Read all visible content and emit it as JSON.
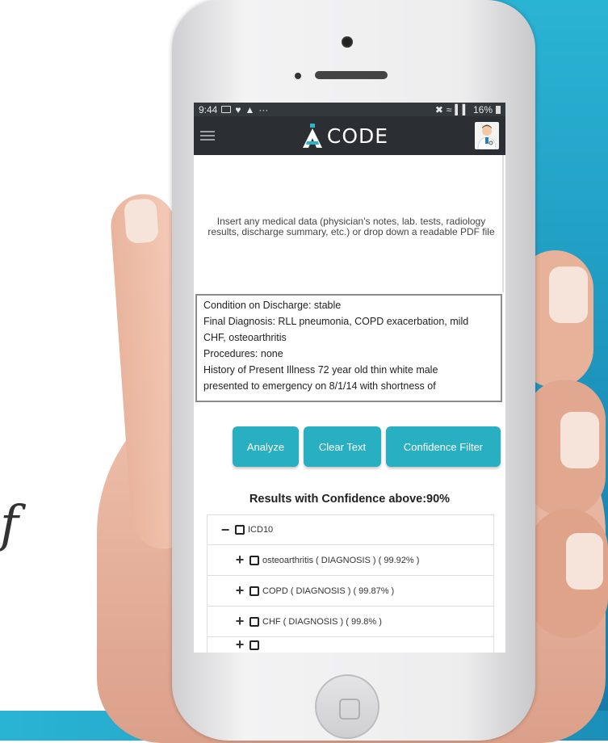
{
  "status_bar": {
    "time": "9:44",
    "battery": "16%"
  },
  "app": {
    "logo_text": "CODE"
  },
  "dropzone": {
    "instruction": "Insert any medical data (physician's notes, lab. tests, radiology results, discharge summary, etc.) or drop down a readable PDF file"
  },
  "input_text": {
    "lines": [
      "Condition on Discharge: stable",
      "Final Diagnosis: RLL pneumonia, COPD exacerbation, mild",
      "CHF, osteoarthritis",
      "Procedures: none",
      "History of Present Illness 72 year old thin white male",
      "presented to emergency on 8/1/14 with shortness of"
    ]
  },
  "buttons": {
    "analyze": "Analyze",
    "clear": "Clear Text",
    "filter": "Confidence Filter"
  },
  "results": {
    "title": "Results with Confidence above:90%",
    "root": "ICD10",
    "items": [
      "osteoarthritis ( DIAGNOSIS ) ( 99.92% )",
      "COPD ( DIAGNOSIS ) ( 99.87% )",
      "CHF ( DIAGNOSIS ) ( 99.8% )"
    ]
  },
  "background": {
    "cut_text": "f"
  },
  "colors": {
    "accent": "#29afc2",
    "appbar": "#2b2f33",
    "background_blue": "#1b8fb8"
  },
  "icons": [
    "menu-icon",
    "logo-icon",
    "doctor-avatar-icon",
    "expand-icon",
    "collapse-icon",
    "checkbox-icon",
    "battery-icon",
    "signal-icon",
    "wifi-icon",
    "message-icon",
    "heart-icon",
    "warning-icon",
    "mute-icon"
  ]
}
